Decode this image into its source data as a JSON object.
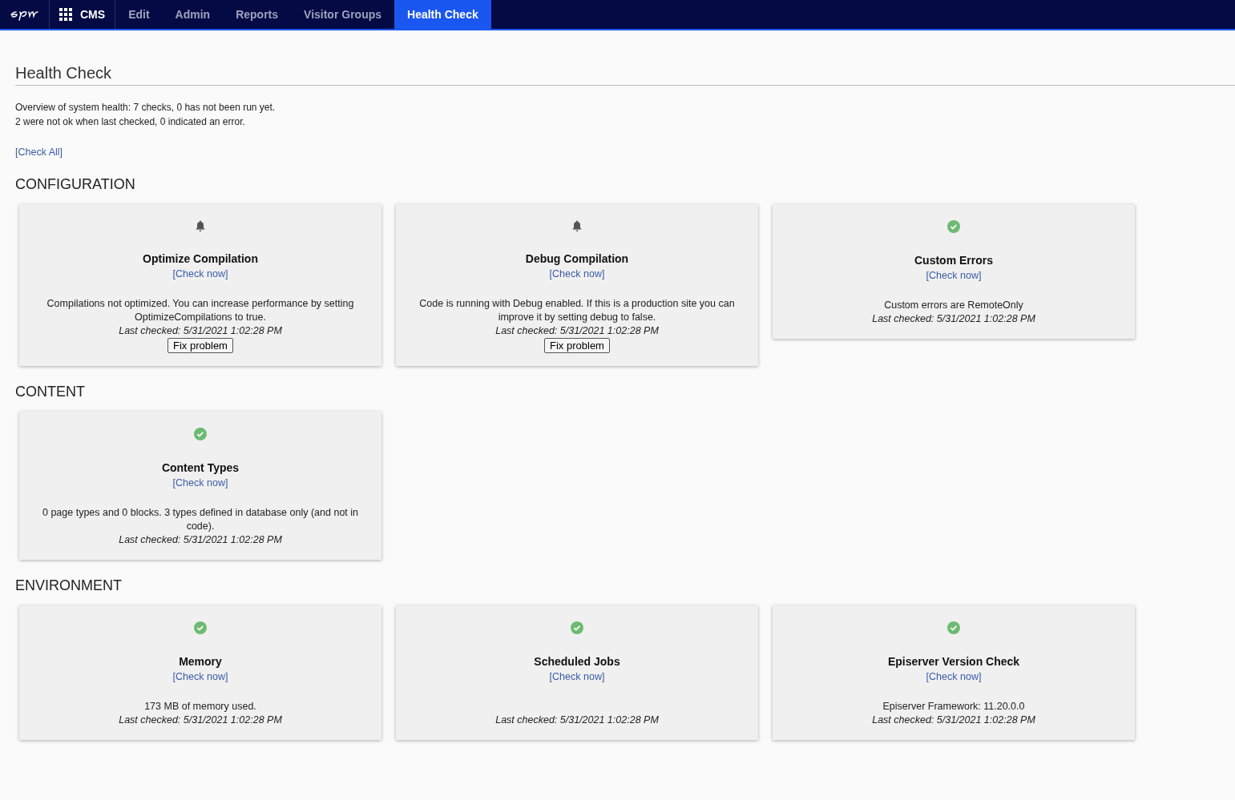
{
  "nav": {
    "product": "CMS",
    "items": [
      {
        "label": "Edit",
        "selected": false
      },
      {
        "label": "Admin",
        "selected": false
      },
      {
        "label": "Reports",
        "selected": false
      },
      {
        "label": "Visitor Groups",
        "selected": false
      },
      {
        "label": "Health Check",
        "selected": true
      }
    ]
  },
  "page": {
    "title": "Health Check",
    "summary": [
      "Overview of system health: 7 checks, 0 has not been run yet.",
      "2 were not ok when last checked, 0 indicated an error."
    ],
    "check_all": "[Check All]"
  },
  "sections": [
    {
      "title": "CONFIGURATION",
      "checks": [
        {
          "kind": "warning",
          "name": "Optimize Compilation",
          "check_now": "[Check now]",
          "message": "Compilations not optimized. You can increase performance by setting OptimizeCompilations to true.",
          "last_checked": "Last checked: 5/31/2021 1:02:28 PM",
          "fix": "Fix problem"
        },
        {
          "kind": "warning",
          "name": "Debug Compilation",
          "check_now": "[Check now]",
          "message": "Code is running with Debug enabled. If this is a production site you can improve it by setting debug to false.",
          "last_checked": "Last checked: 5/31/2021 1:02:28 PM",
          "fix": "Fix problem"
        },
        {
          "kind": "ok",
          "name": "Custom Errors",
          "check_now": "[Check now]",
          "message": "Custom errors are RemoteOnly",
          "last_checked": "Last checked: 5/31/2021 1:02:28 PM"
        }
      ]
    },
    {
      "title": "CONTENT",
      "checks": [
        {
          "kind": "ok",
          "name": "Content Types",
          "check_now": "[Check now]",
          "message": "0 page types and 0 blocks. 3 types defined in database only (and not in code).",
          "last_checked": "Last checked: 5/31/2021 1:02:28 PM"
        }
      ]
    },
    {
      "title": "ENVIRONMENT",
      "checks": [
        {
          "kind": "ok",
          "name": "Memory",
          "check_now": "[Check now]",
          "message": "173 MB of memory used.",
          "last_checked": "Last checked: 5/31/2021 1:02:28 PM"
        },
        {
          "kind": "ok",
          "name": "Scheduled Jobs",
          "check_now": "[Check now]",
          "last_checked": "Last checked: 5/31/2021 1:02:28 PM"
        },
        {
          "kind": "ok",
          "name": "Episerver Version Check",
          "check_now": "[Check now]",
          "message": "Episerver Framework: 11.20.0.0",
          "last_checked": "Last checked: 5/31/2021 1:02:28 PM"
        }
      ]
    }
  ]
}
